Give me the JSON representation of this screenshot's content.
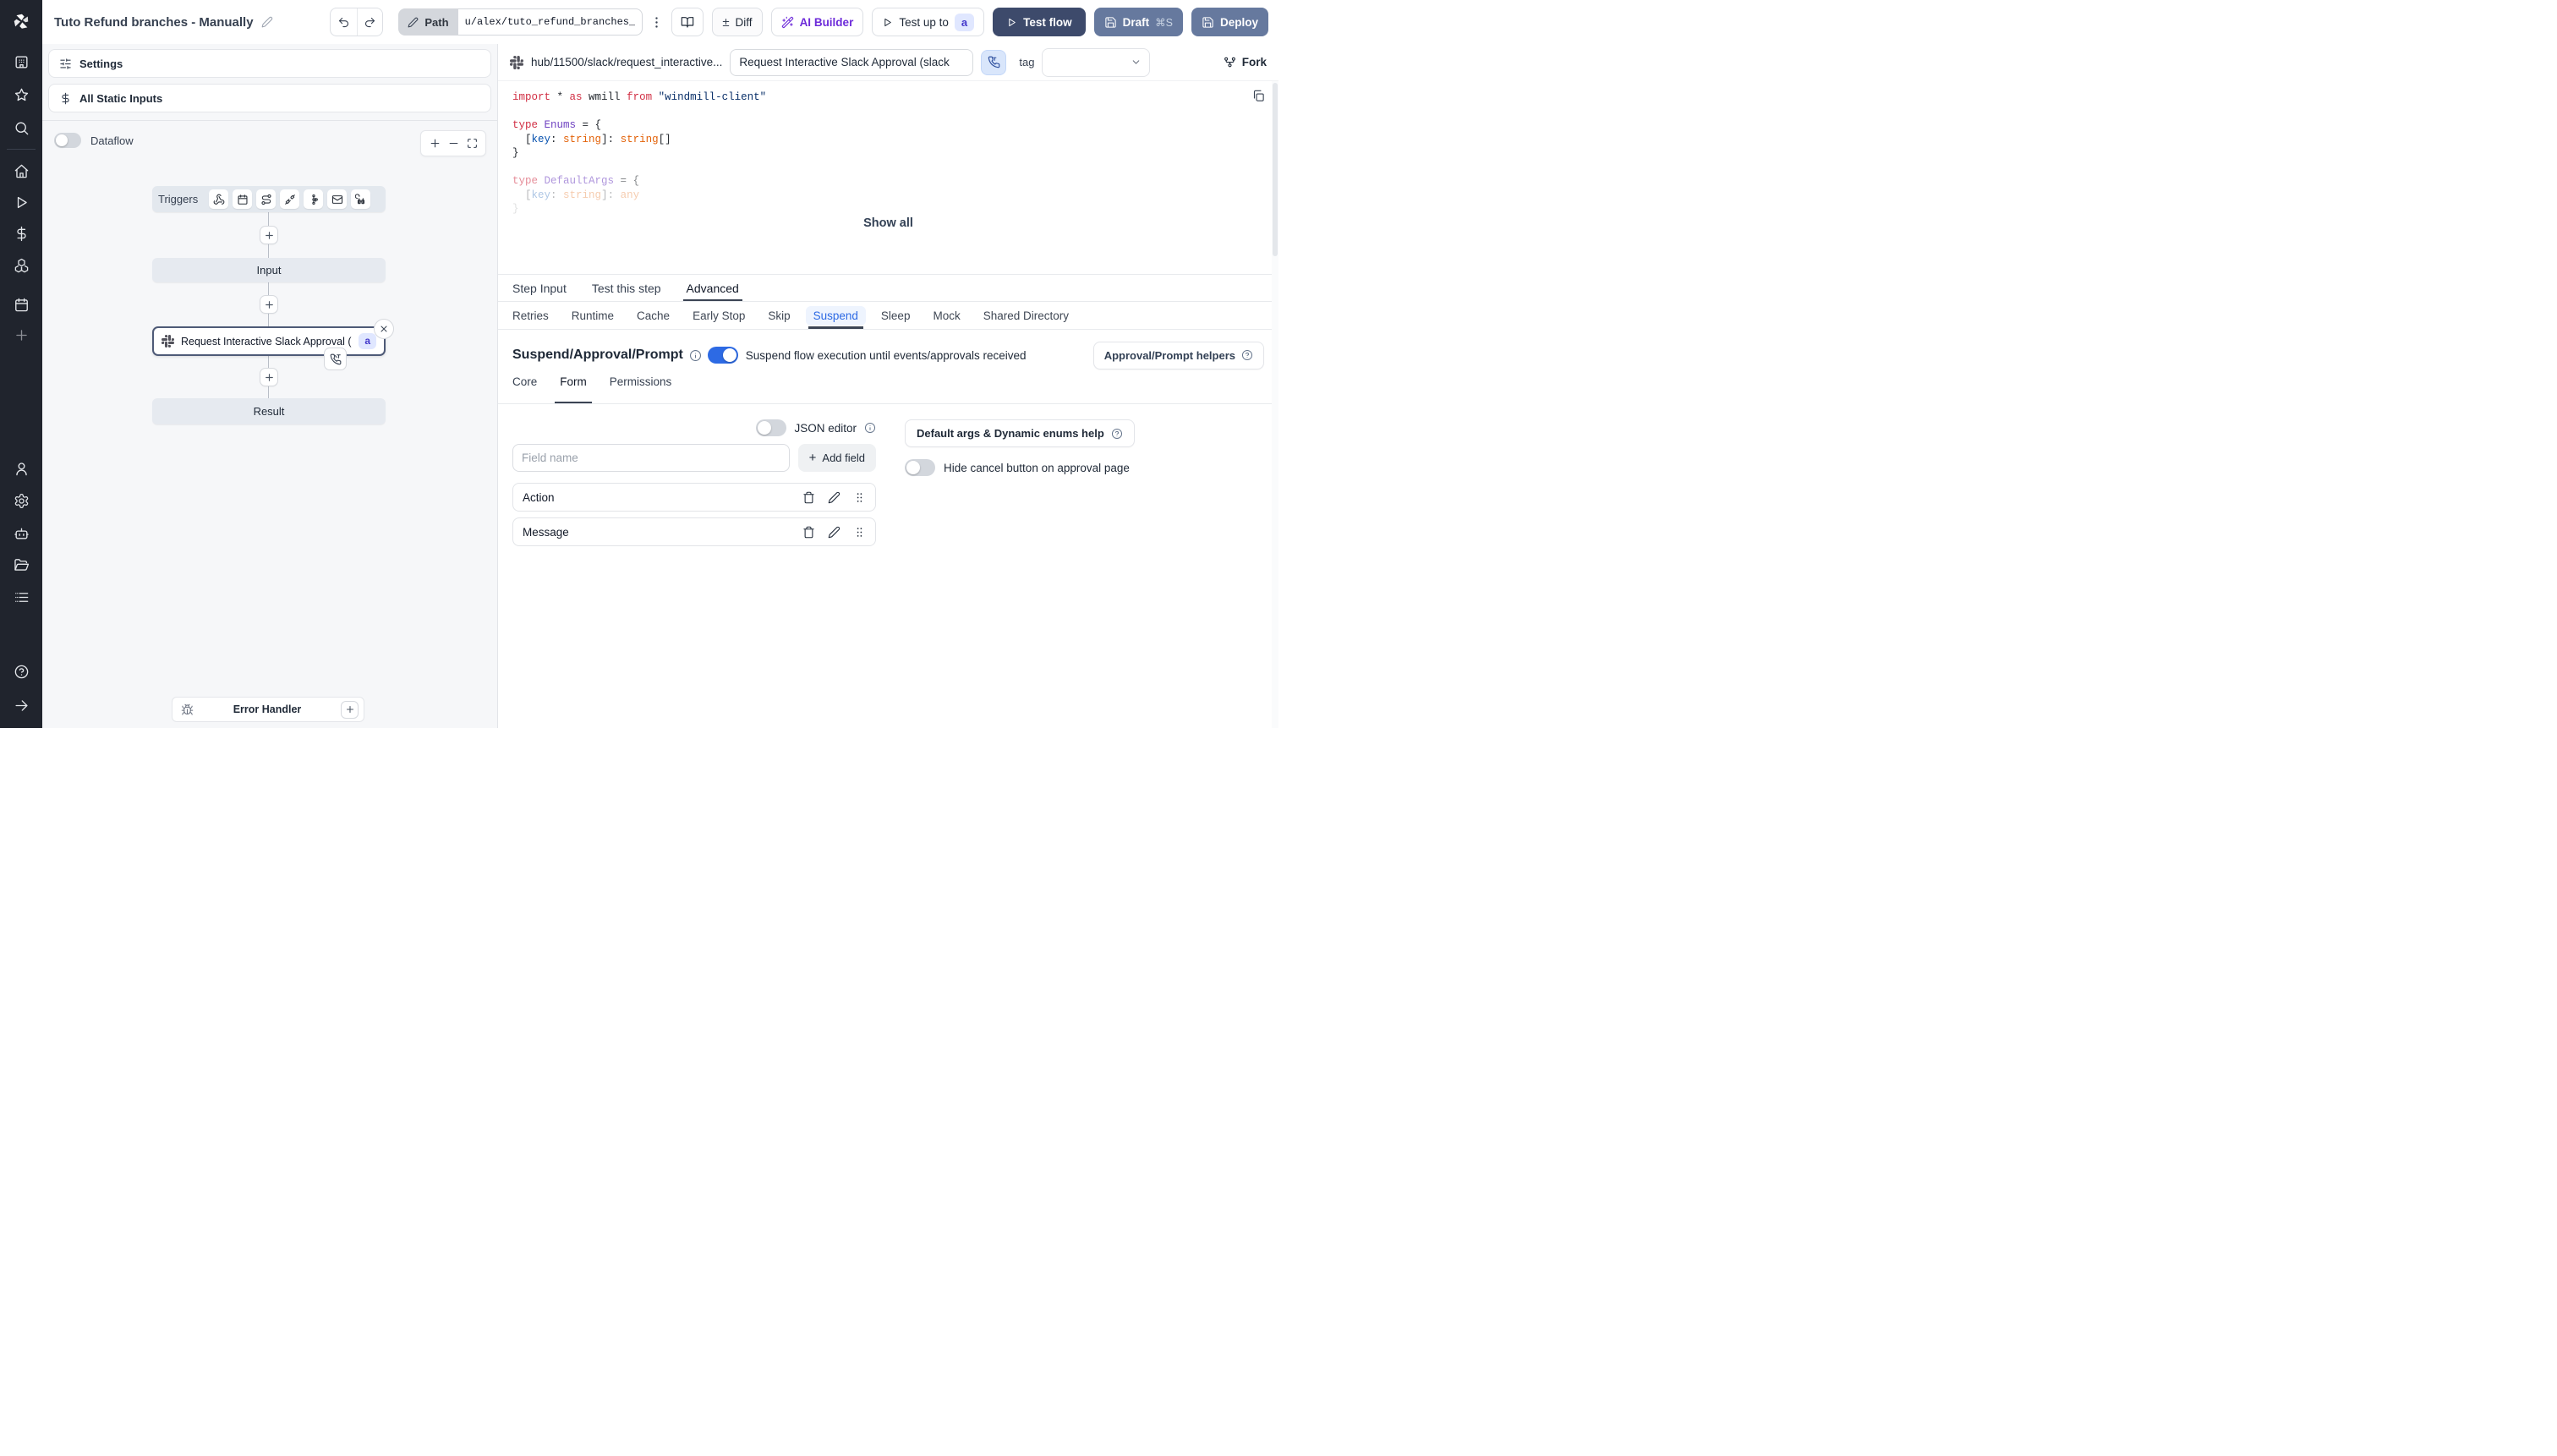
{
  "colors": {
    "accent_blue": "#2d6ae4",
    "node_border": "#4e5a77",
    "test_flow_bg": "#3d4a6b",
    "deploy_bg": "#66799e",
    "ai_purple": "#6d2bd9",
    "badge_bg": "#e0e7ff",
    "badge_text": "#4338ca"
  },
  "topbar": {
    "title": "Tuto Refund branches - Manually",
    "path_label": "Path",
    "path_value": "u/alex/tuto_refund_branches_",
    "diff_label": "Diff",
    "diff_sign": "±",
    "ai_builder_label": "AI Builder",
    "test_up_to_label": "Test up to",
    "test_up_to_badge": "a",
    "test_flow_label": "Test flow",
    "draft_label": "Draft",
    "draft_shortcut": "⌘S",
    "deploy_label": "Deploy"
  },
  "sidebar": {
    "items": [
      "workspace",
      "favorites",
      "search",
      "home",
      "runs",
      "variables",
      "resources",
      "schedules",
      "create",
      "user",
      "settings",
      "ai",
      "folders",
      "logs",
      "help",
      "collapse"
    ]
  },
  "flow_panel": {
    "settings_label": "Settings",
    "static_inputs_label": "All Static Inputs",
    "dataflow_label": "Dataflow",
    "graph": {
      "triggers_label": "Triggers",
      "input_label": "Input",
      "step_label": "Request Interactive Slack Approval (...",
      "step_badge": "a",
      "result_label": "Result",
      "error_handler_label": "Error Handler"
    }
  },
  "right_panel": {
    "hub_path": "hub/11500/slack/request_interactive...",
    "name_value": "Request Interactive Slack Approval (slack",
    "tag_label": "tag",
    "fork_label": "Fork",
    "show_all_label": "Show all",
    "tabs": [
      "Step Input",
      "Test this step",
      "Advanced"
    ],
    "active_tab": "Advanced",
    "subtabs": [
      "Retries",
      "Runtime",
      "Cache",
      "Early Stop",
      "Skip",
      "Suspend",
      "Sleep",
      "Mock",
      "Shared Directory"
    ],
    "active_subtab": "Suspend",
    "code": {
      "lines": [
        {
          "s": [
            {
              "t": "import",
              "c": "kw"
            },
            {
              "t": " * ",
              "c": "pl"
            },
            {
              "t": "as",
              "c": "kw"
            },
            {
              "t": " wmill ",
              "c": "pl"
            },
            {
              "t": "from",
              "c": "kw"
            },
            {
              "t": " ",
              "c": "pl"
            },
            {
              "t": "\"windmill-client\"",
              "c": "str"
            }
          ]
        },
        {
          "s": []
        },
        {
          "s": [
            {
              "t": "type",
              "c": "kw"
            },
            {
              "t": " ",
              "c": "pl"
            },
            {
              "t": "Enums",
              "c": "type"
            },
            {
              "t": " = {",
              "c": "pl"
            }
          ]
        },
        {
          "s": [
            {
              "t": "  [",
              "c": "pl"
            },
            {
              "t": "key",
              "c": "prop"
            },
            {
              "t": ": ",
              "c": "pl"
            },
            {
              "t": "string",
              "c": "tname"
            },
            {
              "t": "]: ",
              "c": "pl"
            },
            {
              "t": "string",
              "c": "tname"
            },
            {
              "t": "[]",
              "c": "pl"
            }
          ]
        },
        {
          "s": [
            {
              "t": "}",
              "c": "pl"
            }
          ]
        },
        {
          "s": []
        },
        {
          "f": 1,
          "s": [
            {
              "t": "type",
              "c": "kw"
            },
            {
              "t": " ",
              "c": "pl"
            },
            {
              "t": "DefaultArgs",
              "c": "type"
            },
            {
              "t": " = {",
              "c": "pl"
            }
          ]
        },
        {
          "f": 2,
          "s": [
            {
              "t": "  [",
              "c": "pl"
            },
            {
              "t": "key",
              "c": "prop"
            },
            {
              "t": ": ",
              "c": "pl"
            },
            {
              "t": "string",
              "c": "tname"
            },
            {
              "t": "]: ",
              "c": "pl"
            },
            {
              "t": "any",
              "c": "tname"
            }
          ]
        },
        {
          "f": 3,
          "s": [
            {
              "t": "}",
              "c": "pl"
            }
          ]
        }
      ]
    },
    "suspend": {
      "title": "Suspend/Approval/Prompt",
      "toggle_label": "Suspend flow execution until events/approvals received",
      "helpers_label": "Approval/Prompt helpers",
      "inner_tabs": [
        "Core",
        "Form",
        "Permissions"
      ],
      "active_inner_tab": "Form",
      "json_editor_label": "JSON editor",
      "field_placeholder": "Field name",
      "add_field_label": "Add field",
      "add_field_sign": "+",
      "default_args_help_label": "Default args & Dynamic enums help",
      "hide_cancel_label": "Hide cancel button on approval page",
      "fields": [
        "Action",
        "Message"
      ]
    }
  }
}
